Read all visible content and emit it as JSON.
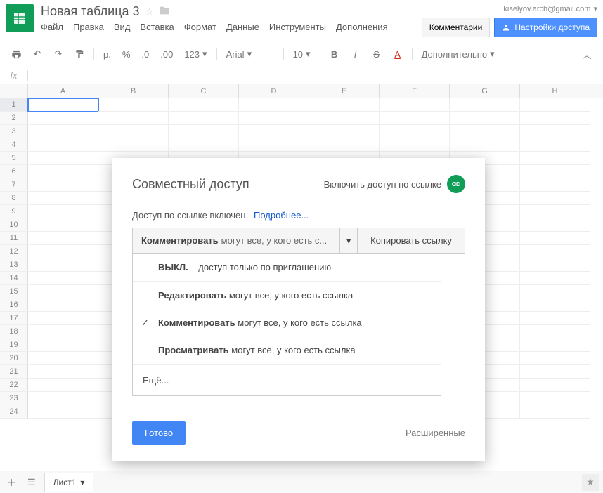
{
  "header": {
    "doc_title": "Новая таблица 3",
    "user_email": "kiselyov.arch@gmail.com",
    "comments_button": "Комментарии",
    "share_button": "Настройки доступа"
  },
  "menus": [
    "Файл",
    "Правка",
    "Вид",
    "Вставка",
    "Формат",
    "Данные",
    "Инструменты",
    "Дополнения"
  ],
  "toolbar": {
    "currency": "p.",
    "percent": "%",
    "dec_dec": ".0",
    "dec_inc": ".00",
    "num_format": "123",
    "font": "Arial",
    "font_size": "10",
    "more": "Дополнительно"
  },
  "fx_label": "fx",
  "columns": [
    "A",
    "B",
    "C",
    "D",
    "E",
    "F",
    "G",
    "H"
  ],
  "rows": [
    1,
    2,
    3,
    4,
    5,
    6,
    7,
    8,
    9,
    10,
    11,
    12,
    13,
    14,
    15,
    16,
    17,
    18,
    19,
    20,
    21,
    22,
    23,
    24
  ],
  "sheet_tab": "Лист1",
  "dialog": {
    "title": "Совместный доступ",
    "toggle_link": "Включить доступ по ссылке",
    "link_status": "Доступ по ссылке включен",
    "learn_more": "Подробнее...",
    "select_bold": "Комментировать",
    "select_rest": "могут все, у кого есть с...",
    "copy_link": "Копировать ссылку",
    "options": [
      {
        "bold": "ВЫКЛ.",
        "rest": " – доступ только по приглашению",
        "checked": false,
        "sep_below": true
      },
      {
        "bold": "Редактировать",
        "rest": " могут все, у кого есть ссылка",
        "checked": false
      },
      {
        "bold": "Комментировать",
        "rest": " могут все, у кого есть ссылка",
        "checked": true
      },
      {
        "bold": "Просматривать",
        "rest": " могут все, у кого есть ссылка",
        "checked": false,
        "sep_below": true
      }
    ],
    "more_option": "Ещё...",
    "done": "Готово",
    "advanced": "Расширенные"
  }
}
